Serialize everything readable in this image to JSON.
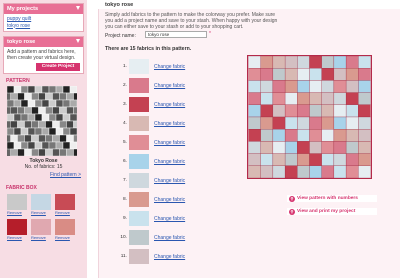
{
  "sidebar": {
    "projects": {
      "title": "My projects",
      "links": [
        "puppy quilt",
        "tokyo rose"
      ]
    },
    "tokyo": {
      "title": "tokyo rose",
      "text": "Add a pattern and fabrics here, then create your virtual design.",
      "create_label": "Create Project",
      "pattern_heading": "PATTERN",
      "pattern_name": "Tokyo Rose",
      "fabric_count": "No. of fabrics: 15",
      "find_link": "Find pattern >"
    },
    "fabric_box": {
      "title": "FABRIC BOX",
      "swatch_label": "Remove",
      "swatch_colors": [
        "#c9c9c9",
        "#c5d7e4",
        "#c84b55",
        "#b51e2a",
        "#e0a8b0",
        "#d98c85"
      ]
    }
  },
  "main": {
    "title": "tokyo rose",
    "intro": "Simply add fabrics to the pattern to make the colorway you prefer. Make sure you add a project name and save to your stash. When happy with your design you can either save to your stash or add to your shopping cart.",
    "project_label": "Project name:",
    "project_value": "tokyo rose",
    "required_mark": "*",
    "fabric_count_text": "There are 15 fabrics in this pattern.",
    "change_label": "Change fabric",
    "fabrics": [
      {
        "num": "1.",
        "color": "#e6eef2"
      },
      {
        "num": "2.",
        "color": "#d97a8c"
      },
      {
        "num": "3.",
        "color": "#c44152"
      },
      {
        "num": "4.",
        "color": "#d8b9b3"
      },
      {
        "num": "5.",
        "color": "#e08e96"
      },
      {
        "num": "6.",
        "color": "#a8d3ea"
      },
      {
        "num": "7.",
        "color": "#cfd8de"
      },
      {
        "num": "8.",
        "color": "#d99a8f"
      },
      {
        "num": "9.",
        "color": "#c9e2ed"
      },
      {
        "num": "10.",
        "color": "#bfc9cc"
      },
      {
        "num": "11.",
        "color": "#d3bfc2"
      }
    ],
    "buttons": [
      "View pattern with numbers",
      "View and print my project"
    ]
  }
}
